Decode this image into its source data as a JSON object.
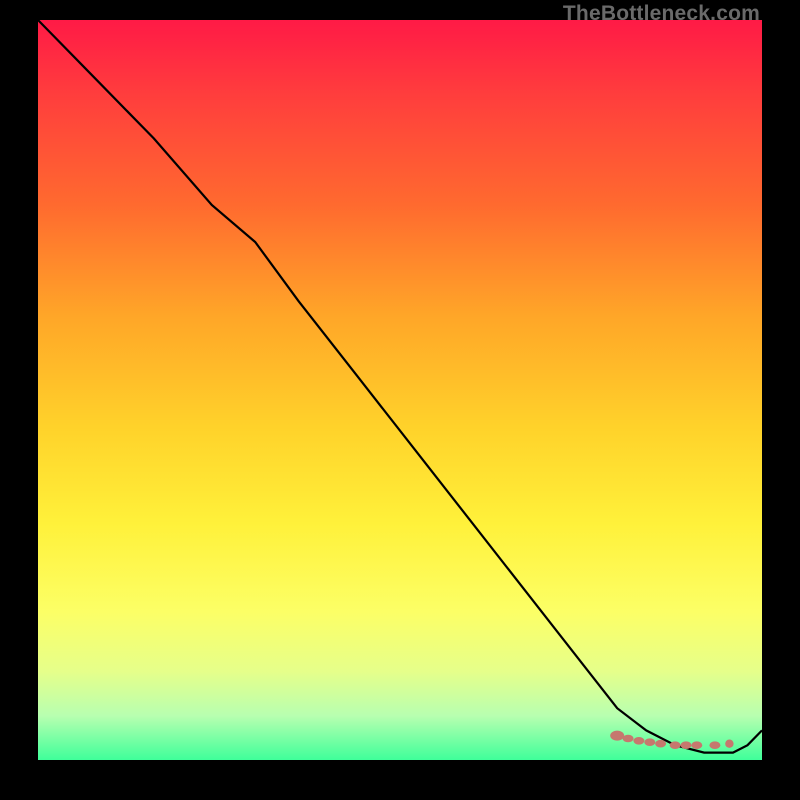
{
  "watermark": "TheBottleneck.com",
  "chart_data": {
    "type": "line",
    "title": "",
    "xlabel": "",
    "ylabel": "",
    "xlim": [
      0,
      100
    ],
    "ylim": [
      0,
      100
    ],
    "grid": false,
    "legend": false,
    "series": [
      {
        "name": "bottleneck-curve",
        "color": "#000000",
        "stroke_width": 2.2,
        "x": [
          0,
          8,
          16,
          24,
          30,
          36,
          44,
          52,
          60,
          68,
          76,
          80,
          84,
          88,
          92,
          94,
          96,
          98,
          100
        ],
        "y": [
          100,
          92,
          84,
          75,
          70,
          62,
          52,
          42,
          32,
          22,
          12,
          7,
          4,
          2,
          1,
          1,
          1,
          2,
          4
        ]
      },
      {
        "name": "selected-range-markers",
        "color": "#c6786e",
        "marker": "blob",
        "x": [
          80,
          81.5,
          83,
          84.5,
          86,
          88,
          89.5,
          91,
          93.5
        ],
        "y": [
          3.3,
          2.9,
          2.6,
          2.4,
          2.2,
          2.0,
          2.0,
          2.0,
          2.0
        ]
      }
    ],
    "background_gradient": {
      "type": "vertical",
      "stops": [
        {
          "pos": 0.0,
          "color": "#ff1a46"
        },
        {
          "pos": 0.1,
          "color": "#ff3d3d"
        },
        {
          "pos": 0.25,
          "color": "#ff6a2f"
        },
        {
          "pos": 0.4,
          "color": "#ffa628"
        },
        {
          "pos": 0.55,
          "color": "#ffd22a"
        },
        {
          "pos": 0.68,
          "color": "#fff13a"
        },
        {
          "pos": 0.8,
          "color": "#fcff66"
        },
        {
          "pos": 0.88,
          "color": "#e6ff8a"
        },
        {
          "pos": 0.94,
          "color": "#b8ffb0"
        },
        {
          "pos": 1.0,
          "color": "#3fff9a"
        }
      ]
    }
  }
}
